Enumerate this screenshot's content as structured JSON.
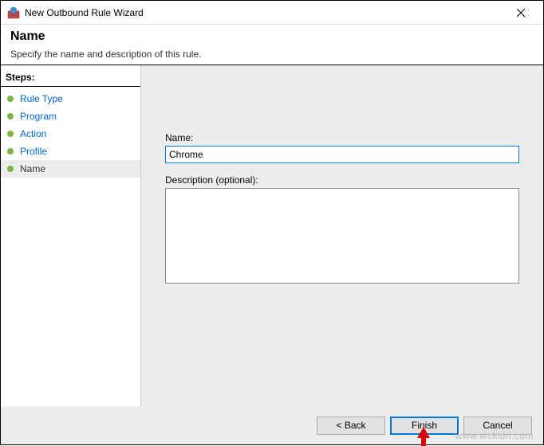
{
  "window": {
    "title": "New Outbound Rule Wizard"
  },
  "header": {
    "title": "Name",
    "subtitle": "Specify the name and description of this rule."
  },
  "sidebar": {
    "title": "Steps:",
    "items": [
      {
        "label": "Rule Type"
      },
      {
        "label": "Program"
      },
      {
        "label": "Action"
      },
      {
        "label": "Profile"
      },
      {
        "label": "Name"
      }
    ]
  },
  "form": {
    "name_label": "Name:",
    "name_value": "Chrome",
    "desc_label": "Description (optional):",
    "desc_value": ""
  },
  "buttons": {
    "back": "< Back",
    "finish": "Finish",
    "cancel": "Cancel"
  },
  "watermark": "www.wskidn.com"
}
